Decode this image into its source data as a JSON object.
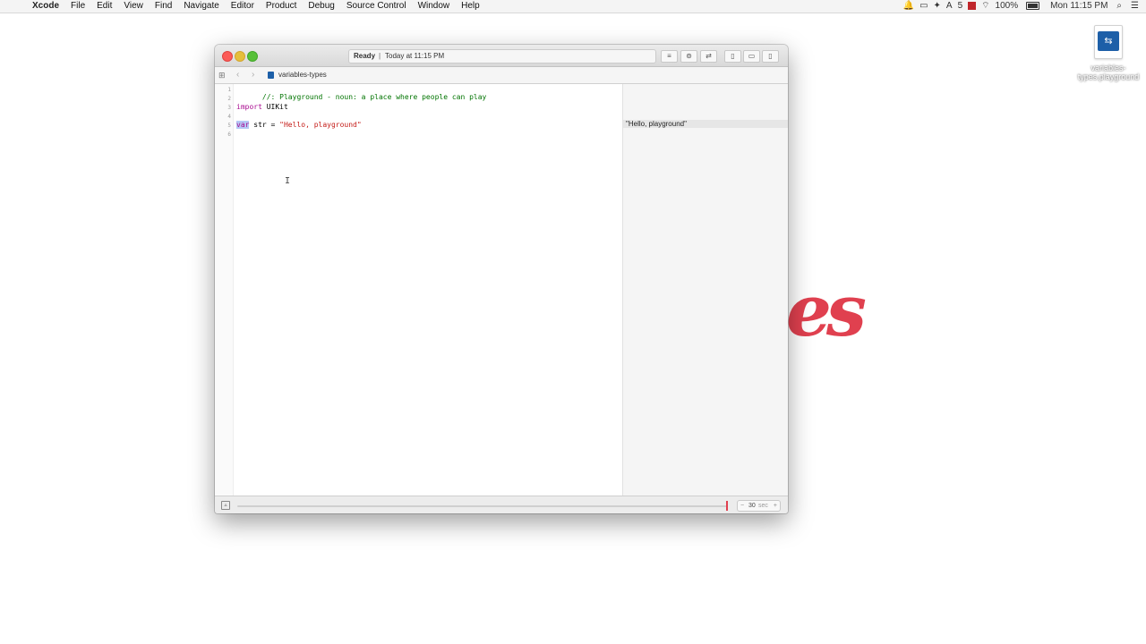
{
  "menubar": {
    "app_name": "Xcode",
    "items": [
      "File",
      "Edit",
      "View",
      "Find",
      "Navigate",
      "Editor",
      "Product",
      "Debug",
      "Source Control",
      "Window",
      "Help"
    ],
    "tray_count": "5",
    "battery": "100%",
    "clock": "Mon 11:15 PM"
  },
  "desktop_file": {
    "name": "variables-types.playground"
  },
  "window": {
    "status": "Ready",
    "status_separator": "|",
    "status_time": "Today at 11:15 PM",
    "breadcrumb": "variables-types"
  },
  "editor": {
    "lines": [
      {
        "num": "1",
        "comment": "//: Playground - noun: a place where people can play"
      },
      {
        "num": "2"
      },
      {
        "num": "3",
        "keyword": "import",
        "rest": " UIKit"
      },
      {
        "num": "4"
      },
      {
        "num": "5",
        "keyword": "var",
        "rest": " str = ",
        "string": "\"Hello, playground\""
      },
      {
        "num": "6"
      }
    ]
  },
  "results": {
    "line5": "\"Hello, playground\""
  },
  "timeline": {
    "duration_value": "30",
    "duration_unit": "sec",
    "minus": "−",
    "plus": "+"
  },
  "colors": {
    "comment": "#007400",
    "keyword": "#aa0d91",
    "string": "#c41a16",
    "accent_red": "#e0404f"
  }
}
